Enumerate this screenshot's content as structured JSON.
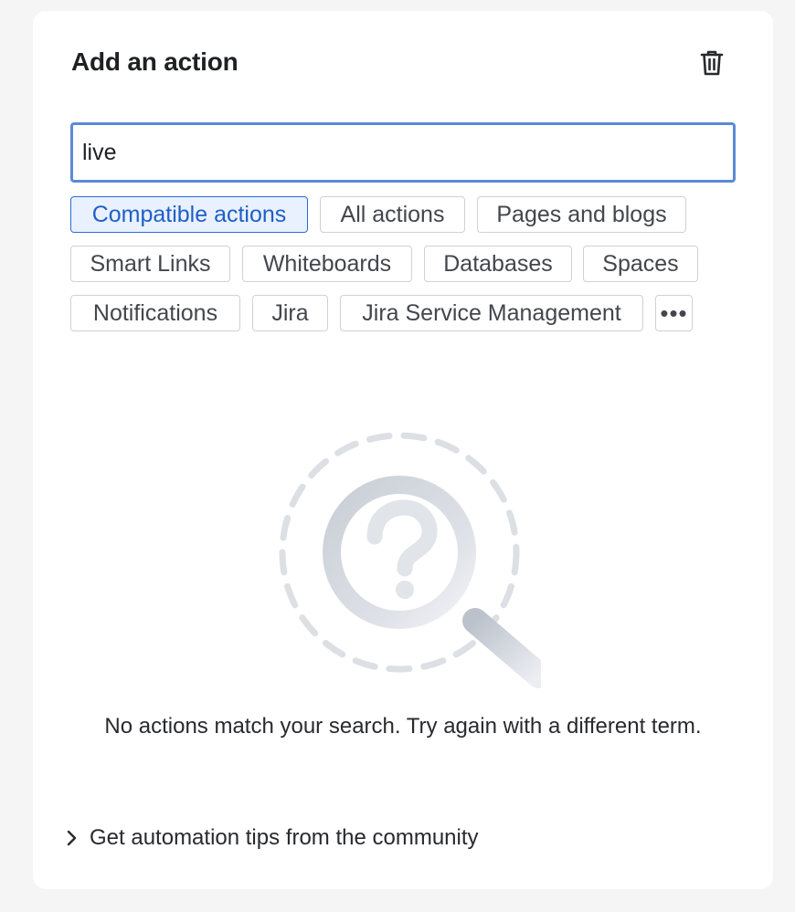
{
  "header": {
    "title": "Add an action",
    "delete_icon": "trash-icon"
  },
  "search": {
    "value": "live",
    "placeholder": ""
  },
  "filters": [
    {
      "label": "Compatible actions",
      "active": true
    },
    {
      "label": "All actions",
      "active": false
    },
    {
      "label": "Pages and blogs",
      "active": false
    },
    {
      "label": "Smart Links",
      "active": false
    },
    {
      "label": "Whiteboards",
      "active": false
    },
    {
      "label": "Databases",
      "active": false
    },
    {
      "label": "Spaces",
      "active": false
    },
    {
      "label": "Notifications",
      "active": false
    },
    {
      "label": "Jira",
      "active": false
    },
    {
      "label": "Jira Service Management",
      "active": false
    }
  ],
  "more_filters": {
    "icon": "more-horizontal-icon",
    "label": "•••"
  },
  "empty_state": {
    "illustration": "magnifier-question-icon",
    "message": "No actions match your search. Try again with a different term."
  },
  "footer": {
    "tips_label": "Get automation tips from the community",
    "icon": "chevron-right-icon"
  },
  "colors": {
    "accent": "#2b6bd6",
    "active_chip_bg": "#e9f1ff",
    "input_border": "#5b8ad6"
  }
}
